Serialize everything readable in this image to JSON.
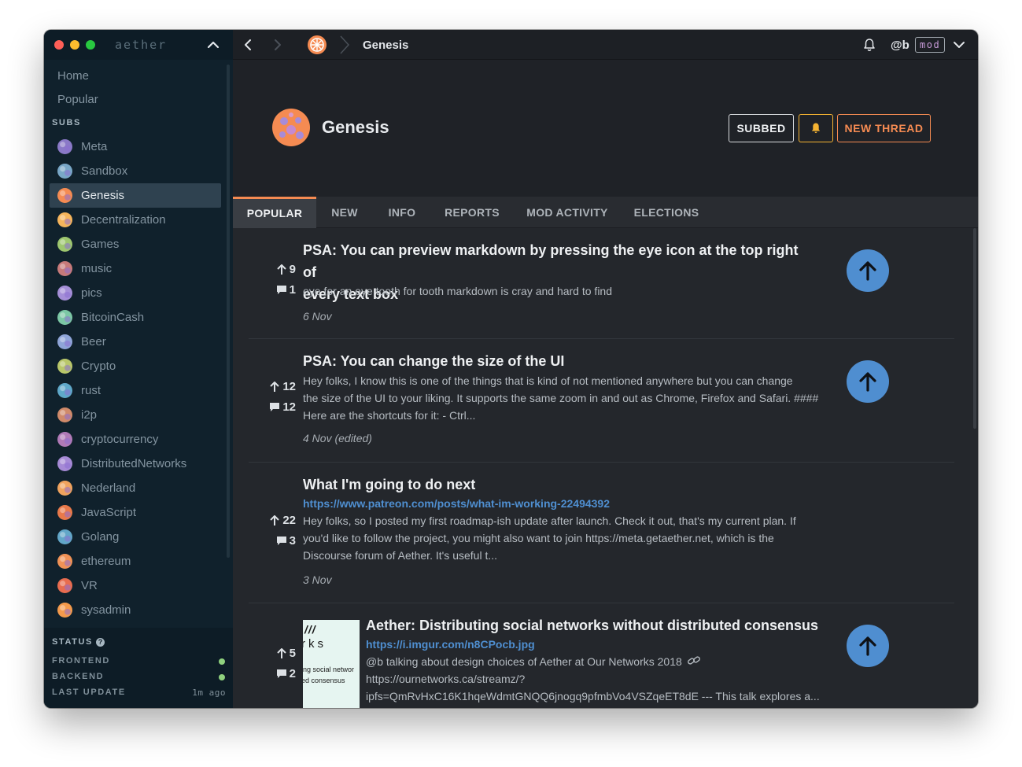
{
  "app": {
    "name": "aether"
  },
  "sidebar": {
    "home_label": "Home",
    "popular_label": "Popular",
    "subs_heading": "SUBS",
    "subs": [
      {
        "name": "Meta",
        "color": "#8a79c7",
        "active": false
      },
      {
        "name": "Sandbox",
        "color": "#79a7c7",
        "active": false
      },
      {
        "name": "Genesis",
        "color": "#f58b52",
        "active": true
      },
      {
        "name": "Decentralization",
        "color": "#f6b55c",
        "active": false
      },
      {
        "name": "Games",
        "color": "#9ec76f",
        "active": false
      },
      {
        "name": "music",
        "color": "#c77a7a",
        "active": false
      },
      {
        "name": "pics",
        "color": "#a58fd8",
        "active": false
      },
      {
        "name": "BitcoinCash",
        "color": "#7cc7a5",
        "active": false
      },
      {
        "name": "Beer",
        "color": "#8fa5d8",
        "active": false
      },
      {
        "name": "Crypto",
        "color": "#b9c76a",
        "active": false
      },
      {
        "name": "rust",
        "color": "#5fa8c9",
        "active": false
      },
      {
        "name": "i2p",
        "color": "#d08a6a",
        "active": false
      },
      {
        "name": "cryptocurrency",
        "color": "#b07ab7",
        "active": false
      },
      {
        "name": "DistributedNetworks",
        "color": "#a68ad6",
        "active": false
      },
      {
        "name": "Nederland",
        "color": "#f0a35e",
        "active": false
      },
      {
        "name": "JavaScript",
        "color": "#e8794a",
        "active": false
      },
      {
        "name": "Golang",
        "color": "#62a6c8",
        "active": false
      },
      {
        "name": "ethereum",
        "color": "#f09256",
        "active": false
      },
      {
        "name": "VR",
        "color": "#e86c4f",
        "active": false
      },
      {
        "name": "sysadmin",
        "color": "#f49a4c",
        "active": false
      }
    ],
    "status": {
      "heading": "STATUS",
      "frontend_label": "FRONTEND",
      "backend_label": "BACKEND",
      "last_update_label": "LAST UPDATE",
      "last_update_value": "1m ago",
      "ok_color": "#8fd17e"
    }
  },
  "topbar": {
    "breadcrumb": "Genesis",
    "user": "@b",
    "badge": "mod"
  },
  "board": {
    "title": "Genesis",
    "subbed_label": "SUBBED",
    "new_thread_label": "NEW THREAD",
    "accent_color": "#f58b52"
  },
  "tabs": [
    {
      "label": "POPULAR",
      "active": true
    },
    {
      "label": "NEW",
      "active": false
    },
    {
      "label": "INFO",
      "active": false
    },
    {
      "label": "REPORTS",
      "active": false
    },
    {
      "label": "MOD ACTIVITY",
      "active": false
    },
    {
      "label": "ELECTIONS",
      "active": false
    }
  ],
  "threads": [
    {
      "title_line1": "PSA: You can preview markdown by pressing the eye icon at the top right of",
      "title_line2": "every text box",
      "body": "eye for an eye tooth for tooth markdown is cray and hard to find",
      "date": "6 Nov",
      "upvotes": "9",
      "comments": "1"
    },
    {
      "title": "PSA: You can change the size of the UI",
      "body_line1": "Hey folks, I know this is one of the things that is kind of not mentioned anywhere but you can change",
      "body_line2": "the size of the UI to your liking. It supports the same zoom in and out as Chrome, Firefox and Safari. ####",
      "body_line3": "Here are the shortcuts for it: - Ctrl...",
      "date": "4 Nov (edited)",
      "upvotes": "12",
      "comments": "12"
    },
    {
      "title": "What I'm going to do next",
      "link": "https://www.patreon.com/posts/what-im-working-22494392",
      "body_line1": "Hey folks, so I posted my first roadmap-ish update after launch. Check it out, that's my current plan. If",
      "body_line2": "you'd like to follow the project, you might also want to join https://meta.getaether.net, which is the",
      "body_line3": "Discourse forum of Aether. It's useful t...",
      "date": "3 Nov",
      "upvotes": "22",
      "comments": "3"
    },
    {
      "title": "Aether: Distributing social networks without distributed consensus",
      "link": "https://i.imgur.com/n8CPocb.jpg",
      "body_line1": "@b talking about design choices of Aether at Our Networks 2018",
      "body_line2": "https://ournetworks.ca/streamz/?",
      "body_line3": "ipfs=QmRvHxC16K1hqeWdmtGNQQ6jnogq9pfmbVo4VSZqeET8dE --- This talk explores a...",
      "thumb_line1": "rks",
      "thumb_line2": "ing social networ",
      "thumb_line3": "ed consensus",
      "upvotes": "5",
      "comments": "2"
    }
  ]
}
